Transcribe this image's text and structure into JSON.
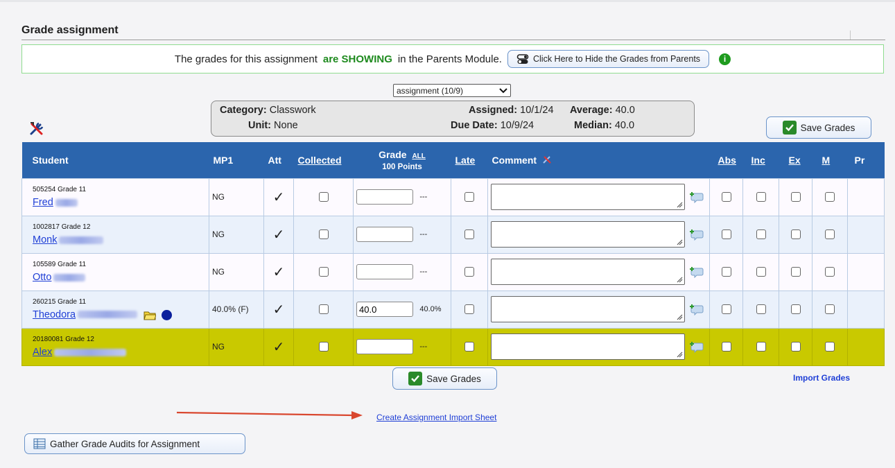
{
  "section": {
    "title": "Grade assignment"
  },
  "notice": {
    "text_before": "The grades for this assignment",
    "status": "are SHOWING",
    "text_after": "in the Parents Module.",
    "hide_button_label": "Click Here to Hide the Grades from Parents",
    "info_icon": "info-icon"
  },
  "assignment_select": {
    "value": "assignment (10/9)"
  },
  "info": {
    "category_label": "Category:",
    "category_value": "Classwork",
    "unit_label": "Unit:",
    "unit_value": "None",
    "assigned_label": "Assigned:",
    "assigned_value": "10/1/24",
    "due_label": "Due Date:",
    "due_value": "10/9/24",
    "average_label": "Average:",
    "average_value": "40.0",
    "median_label": "Median:",
    "median_value": "40.0"
  },
  "save_label": "Save Grades",
  "table": {
    "headers": {
      "student": "Student",
      "mp1": "MP1",
      "att": "Att",
      "collected": "Collected",
      "grade": "Grade",
      "grade_all": "ALL",
      "grade_points": "100 Points",
      "late": "Late",
      "comment": "Comment",
      "abs": "Abs",
      "inc": "Inc",
      "ex": "Ex",
      "m": "M",
      "pr": "Pr"
    },
    "rows": [
      {
        "meta": "505254  Grade 11",
        "first_name": "Fred",
        "mp1": "NG",
        "att": "✓",
        "grade": "",
        "pct": "---"
      },
      {
        "meta": "1002817  Grade 12",
        "first_name": "Monk",
        "mp1": "NG",
        "att": "✓",
        "grade": "",
        "pct": "---"
      },
      {
        "meta": "105589  Grade 11",
        "first_name": "Otto",
        "mp1": "NG",
        "att": "✓",
        "grade": "",
        "pct": "---"
      },
      {
        "meta": "260215  Grade 11",
        "first_name": "Theodora",
        "mp1": "40.0% (F)",
        "att": "✓",
        "grade": "40.0",
        "pct": "40.0%"
      },
      {
        "meta": "20180081  Grade 12",
        "first_name": "Alex",
        "mp1": "NG",
        "att": "✓",
        "grade": "",
        "pct": "---"
      }
    ]
  },
  "links": {
    "import_grades": "Import Grades",
    "create_import_sheet": "Create Assignment Import Sheet"
  },
  "audit_button_label": "Gather Grade Audits for Assignment",
  "colors": {
    "header_blue": "#2b65ad",
    "highlight_row": "#c9c900",
    "showing_green": "#1e8a1e",
    "link_blue": "#1f3fd6",
    "arrow_red": "#d9472f"
  }
}
